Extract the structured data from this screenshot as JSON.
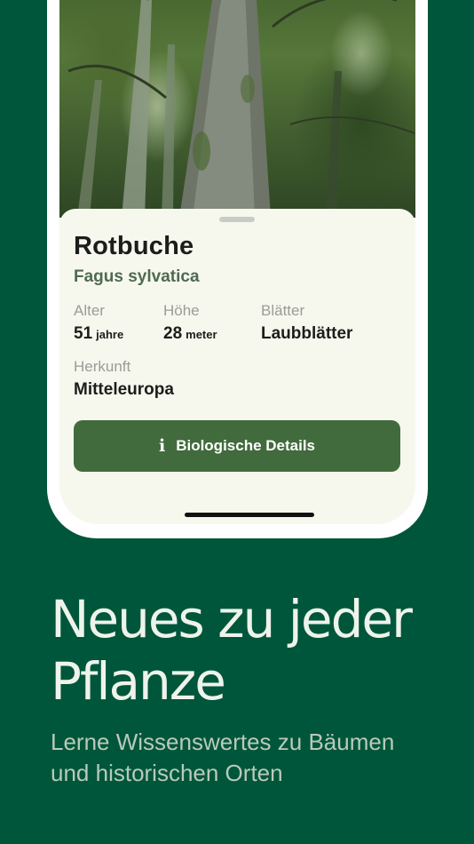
{
  "plant": {
    "common_name": "Rotbuche",
    "latin_name": "Fagus sylvatica",
    "attributes": {
      "age": {
        "label": "Alter",
        "value": "51",
        "unit": "jahre"
      },
      "height": {
        "label": "Höhe",
        "value": "28",
        "unit": "meter"
      },
      "leaves": {
        "label": "Blätter",
        "value": "Laubblätter"
      },
      "origin": {
        "label": "Herkunft",
        "value": "Mitteleuropa"
      }
    }
  },
  "details_button": {
    "icon": "info-icon",
    "icon_glyph": "i",
    "label": "Biologische Details"
  },
  "promo": {
    "headline_line1": "Neues zu jeder",
    "headline_line2": "Pflanze",
    "tagline_line1": "Lerne Wissenswertes zu Bäumen",
    "tagline_line2": "und historischen Orten"
  },
  "colors": {
    "background": "#00563a",
    "button": "#416b3c",
    "sheet": "#f6f8ee"
  }
}
